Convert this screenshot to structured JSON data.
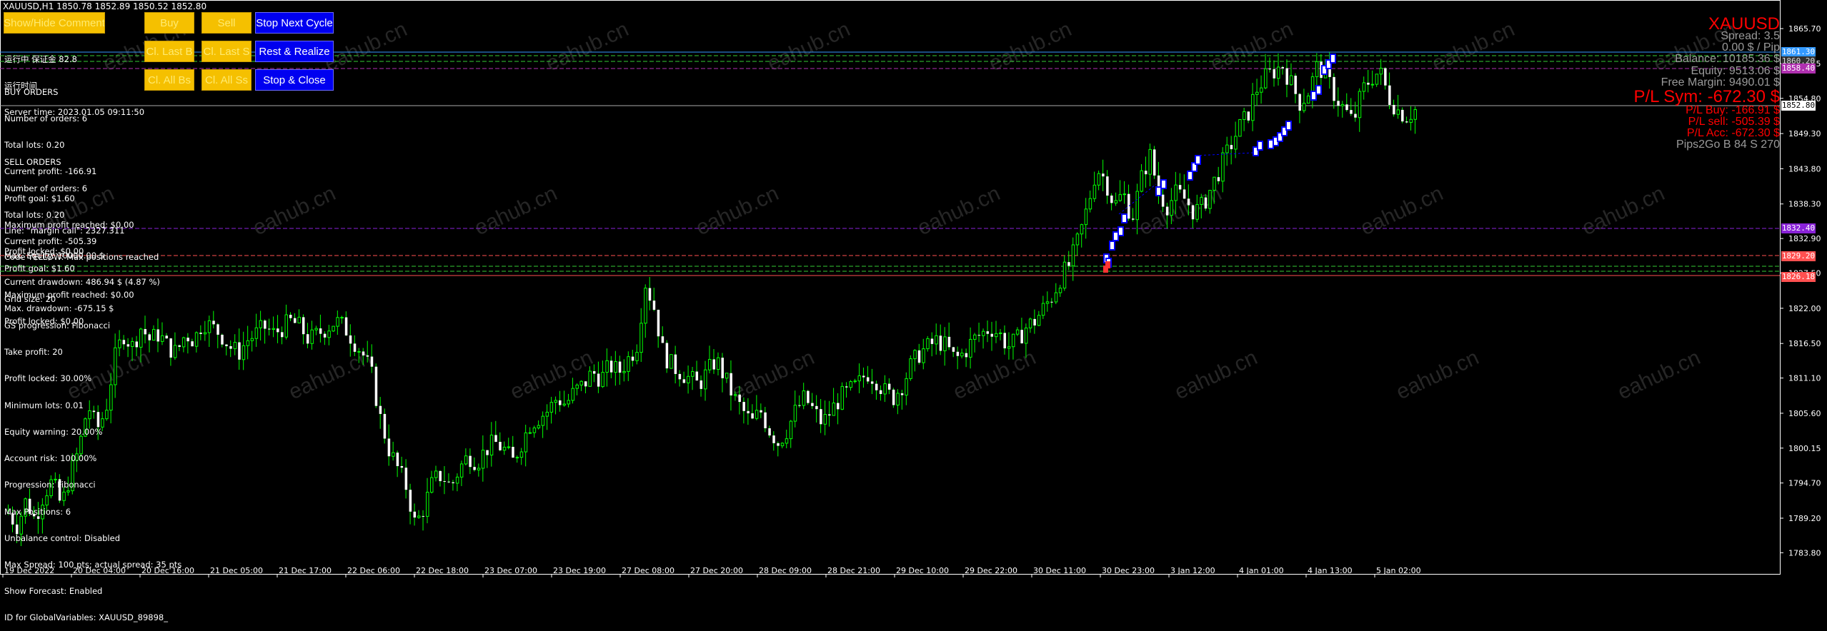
{
  "header": {
    "symbol_line": "XAUUSD,H1  1850.78 1852.89 1850.52 1852.80"
  },
  "buttons": {
    "show_hide_comment": "Show/Hide Comment",
    "buy": "Buy",
    "sell": "Sell",
    "stop_next_cycle": "Stop Next Cycle",
    "close_last_buy": "Cl. Last B",
    "close_last_sell": "Cl. Last S",
    "rest_realize": "Rest & Realize",
    "close_all_buys": "Cl. All Bs",
    "close_all_sells": "Cl. All Ss",
    "stop_close": "Stop & Close"
  },
  "comment_top": [
    "运行中 保证金 82.8",
    "运行时间",
    "Server time: 2023.01.05 09:11:50"
  ],
  "buy_orders": [
    "BUY ORDERS",
    "Number of orders: 6",
    "Total lots: 0.20",
    "Current profit: -166.91",
    "Profit goal: $1.60",
    "Maximum profit reached: $0.00",
    "Profit locked: $0.00"
  ],
  "sell_orders": [
    "SELL ORDERS",
    "Number of orders: 6",
    "Total lots: 0.20",
    "Current profit: -505.39",
    "Profit goal: $1.60",
    "Maximum profit reached: $0.00",
    "Profit locked: $0.00"
  ],
  "margin_info": [
    "Line: \"margin call\": 2327.311",
    "Code YELLOW: Max positions reached"
  ],
  "equity_info": [
    "Max. Equity: 10000.00 $",
    "Current drawdown: 486.94 $ (4.87 %)",
    "Max. drawdown: -675.15 $"
  ],
  "settings_info": [
    "Grid size: 20",
    "GS progression: Fibonacci",
    "Take profit: 20",
    "Profit locked: 30.00%",
    "Minimum lots: 0.01",
    "Equity warning: 20.00%",
    "Account risk: 100.00%",
    "Progression: Fibonacci",
    "Max Positions: 6",
    "Unbalance control: Disabled",
    "Max Spread: 100 pts; actual spread: 35 pts",
    "Show Forecast: Enabled",
    "ID for GlobalVariables: XAUUSD_89898_"
  ],
  "account_panel": {
    "symbol": "XAUUSD",
    "spread": "Spread: 3.5",
    "pip_value": "0.00 $ / Pip",
    "balance": "Balance: 10185.36 $",
    "equity": "Equity: 9513.06 $",
    "free_margin": "Free Margin: 9490.01 $",
    "pl_sym": "P/L Sym: -672.30 $",
    "pl_buy": "P/L Buy: -166.91 $",
    "pl_sell": "P/L sell: -505.39 $",
    "pl_acc": "P/L Acc: -672.30 $",
    "pips2go": "Pips2Go B 84 S 270",
    "colors": {
      "red": "#ff0000",
      "grey": "#9a9a9a"
    }
  },
  "price_tags": {
    "p1": "1861.30",
    "p2": "1860.20",
    "p3": "1858.40",
    "current": "1852.80",
    "p5": "1832.40",
    "p6": "1829.20",
    "p7": "1826.18"
  },
  "watermark": "eahub.cn",
  "chart_data": {
    "type": "candlestick",
    "symbol": "XAUUSD",
    "timeframe": "H1",
    "ylim": [
      1781.5,
      1869.5
    ],
    "y_ticks": [
      "1865.70",
      "1860.25",
      "1854.80",
      "1849.30",
      "1843.80",
      "1838.30",
      "1832.90",
      "1827.50",
      "1822.00",
      "1816.50",
      "1811.10",
      "1805.60",
      "1800.15",
      "1794.70",
      "1789.20",
      "1783.80"
    ],
    "y_tick_values": [
      1865.7,
      1860.25,
      1854.8,
      1849.3,
      1843.8,
      1838.3,
      1832.9,
      1827.5,
      1822.0,
      1816.5,
      1811.1,
      1805.6,
      1800.15,
      1794.7,
      1789.2,
      1783.8
    ],
    "x_ticks": [
      "19 Dec 2022",
      "20 Dec 04:00",
      "20 Dec 16:00",
      "21 Dec 05:00",
      "21 Dec 17:00",
      "22 Dec 06:00",
      "22 Dec 18:00",
      "23 Dec 07:00",
      "23 Dec 19:00",
      "27 Dec 08:00",
      "27 Dec 20:00",
      "28 Dec 09:00",
      "28 Dec 21:00",
      "29 Dec 10:00",
      "29 Dec 22:00",
      "30 Dec 11:00",
      "30 Dec 23:00",
      "3 Jan 12:00",
      "4 Jan 01:00",
      "4 Jan 13:00",
      "5 Jan 02:00"
    ],
    "close_path": [
      1790,
      1788,
      1792,
      1789,
      1793,
      1795,
      1791,
      1796,
      1800,
      1807,
      1803,
      1806,
      1814,
      1818,
      1816,
      1819,
      1817,
      1818,
      1816,
      1815,
      1818,
      1817,
      1820,
      1819,
      1818,
      1816,
      1815,
      1817,
      1818,
      1819,
      1818,
      1819,
      1820,
      1819,
      1817,
      1818,
      1819,
      1820,
      1819,
      1817,
      1815,
      1812,
      1805,
      1800,
      1797,
      1794,
      1788,
      1791,
      1795,
      1796,
      1794,
      1797,
      1799,
      1798,
      1800,
      1801,
      1800,
      1798,
      1801,
      1804,
      1805,
      1806,
      1808,
      1807,
      1809,
      1810,
      1812,
      1811,
      1813,
      1812,
      1814,
      1816,
      1826,
      1822,
      1815,
      1813,
      1812,
      1811,
      1810,
      1812,
      1814,
      1811,
      1808,
      1806,
      1804,
      1806,
      1803,
      1801,
      1803,
      1806,
      1808,
      1806,
      1804,
      1806,
      1808,
      1809,
      1810,
      1812,
      1811,
      1809,
      1808,
      1810,
      1813,
      1815,
      1816,
      1817,
      1816,
      1814,
      1815,
      1817,
      1818,
      1819,
      1818,
      1816,
      1817,
      1819,
      1820,
      1822,
      1824,
      1827,
      1829,
      1833,
      1838,
      1844,
      1842,
      1838,
      1840,
      1836,
      1842,
      1846,
      1840,
      1838,
      1840,
      1839,
      1837,
      1838,
      1841,
      1844,
      1847,
      1850,
      1852,
      1856,
      1858,
      1859,
      1860,
      1857,
      1854,
      1856,
      1860,
      1858,
      1855,
      1853,
      1851,
      1856,
      1858,
      1859,
      1855,
      1853,
      1852,
      1853
    ]
  }
}
